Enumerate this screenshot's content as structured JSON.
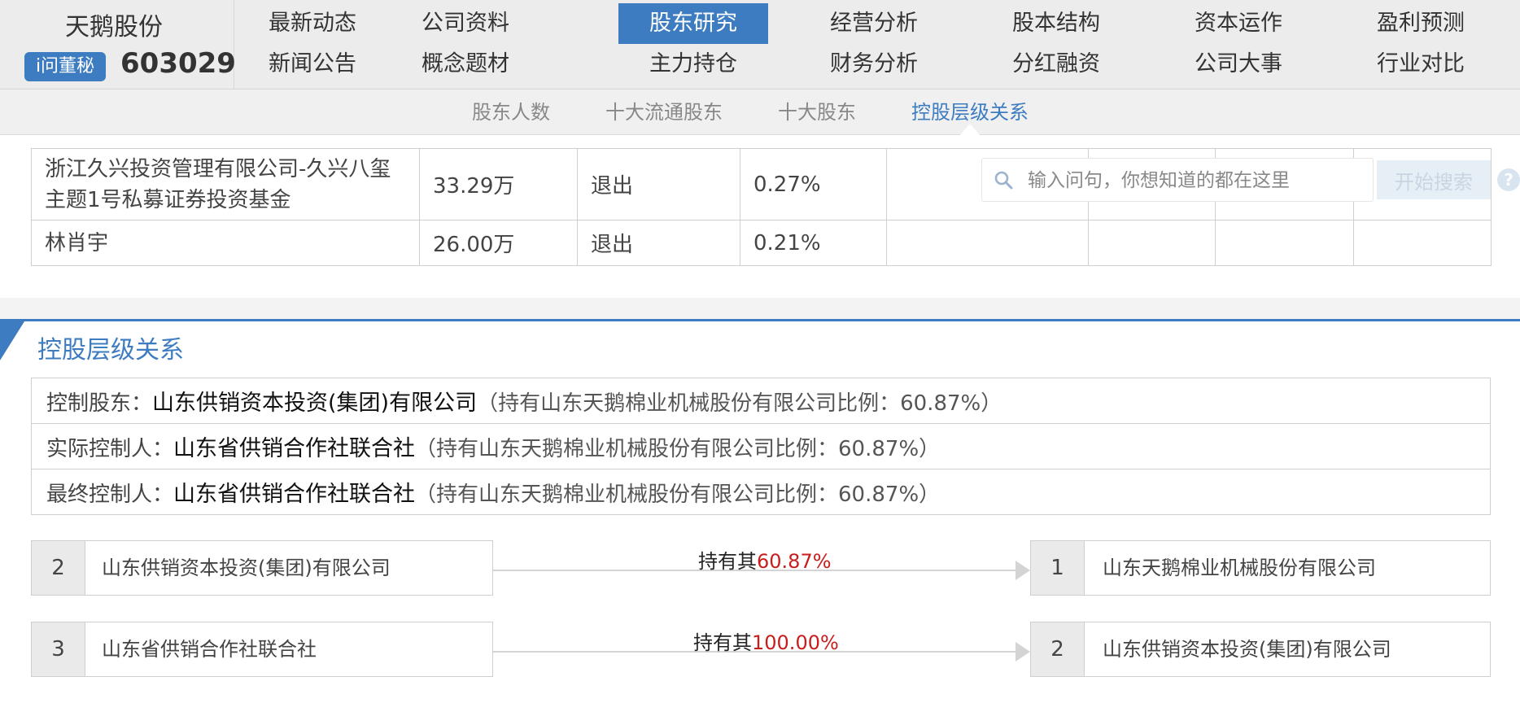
{
  "brand": {
    "name": "天鹅股份",
    "ask_label": "i问董秘",
    "code": "603029"
  },
  "nav": {
    "row1": [
      "最新动态",
      "公司资料",
      "股东研究",
      "经营分析",
      "股本结构",
      "资本运作",
      "盈利预测"
    ],
    "row2": [
      "新闻公告",
      "概念题材",
      "主力持仓",
      "财务分析",
      "分红融资",
      "公司大事",
      "行业对比"
    ],
    "active": "股东研究"
  },
  "subnav": {
    "items": [
      "股东人数",
      "十大流通股东",
      "十大股东",
      "控股层级关系"
    ],
    "active": "控股层级关系"
  },
  "holders": [
    {
      "name": "浙江久兴投资管理有限公司-久兴八玺主题1号私募证券投资基金",
      "shares": "33.29万",
      "action": "退出",
      "ratio": "0.27%"
    },
    {
      "name": "林肖宇",
      "shares": "26.00万",
      "action": "退出",
      "ratio": "0.21%"
    }
  ],
  "search": {
    "placeholder": "输入问句，你想知道的都在这里",
    "button": "开始搜索",
    "help": "?"
  },
  "section": {
    "title": "控股层级关系"
  },
  "control": [
    {
      "label": "控制股东：",
      "entity": "山东供销资本投资(集团)有限公司",
      "note": "（持有山东天鹅棉业机械股份有限公司比例：60.87%）"
    },
    {
      "label": "实际控制人：",
      "entity": "山东省供销合作社联合社",
      "note": "（持有山东天鹅棉业机械股份有限公司比例：60.87%）"
    },
    {
      "label": "最终控制人：",
      "entity": "山东省供销合作社联合社",
      "note": "（持有山东天鹅棉业机械股份有限公司比例：60.87%）"
    }
  ],
  "chain": [
    {
      "from_level": "2",
      "from_name": "山东供销资本投资(集团)有限公司",
      "hold_text": "持有其",
      "hold_pct": "60.87%",
      "to_level": "1",
      "to_name": "山东天鹅棉业机械股份有限公司"
    },
    {
      "from_level": "3",
      "from_name": "山东省供销合作社联合社",
      "hold_text": "持有其",
      "hold_pct": "100.00%",
      "to_level": "2",
      "to_name": "山东供销资本投资(集团)有限公司"
    }
  ],
  "colors": {
    "accent": "#3d7cc1",
    "highlight": "#c81d1d"
  }
}
